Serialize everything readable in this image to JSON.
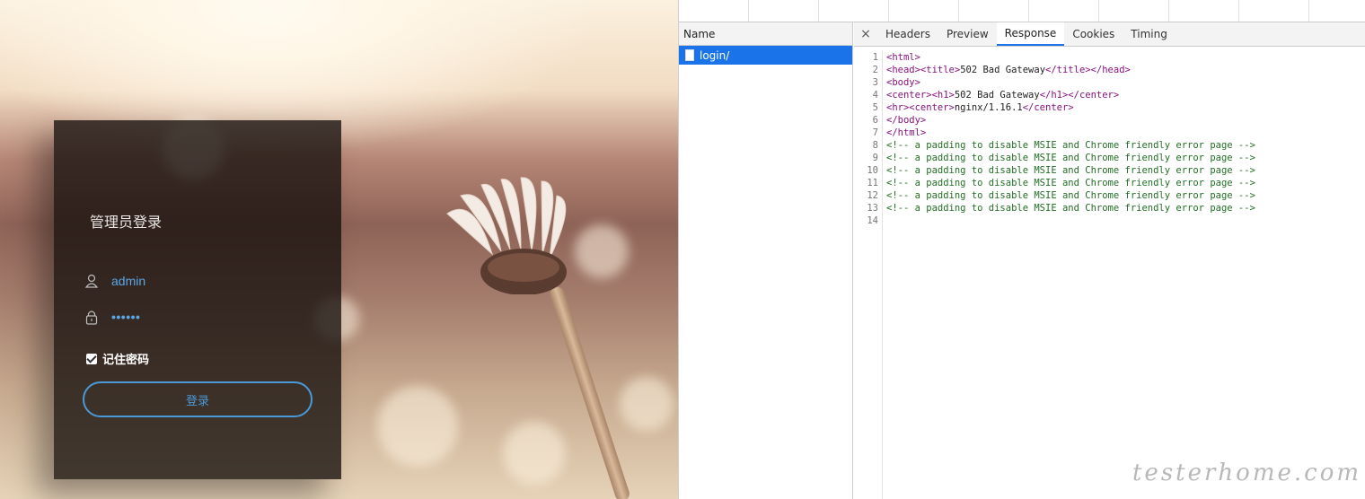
{
  "login": {
    "title": "管理员登录",
    "username": "admin",
    "password_masked": "••••••",
    "remember_label": "记住密码",
    "remember_checked": true,
    "button_label": "登录"
  },
  "devtools": {
    "name_header": "Name",
    "requests": [
      {
        "name": "login/",
        "selected": true
      }
    ],
    "tabs": [
      {
        "label": "Headers",
        "active": false
      },
      {
        "label": "Preview",
        "active": false
      },
      {
        "label": "Response",
        "active": true
      },
      {
        "label": "Cookies",
        "active": false
      },
      {
        "label": "Timing",
        "active": false
      }
    ],
    "close_glyph": "×",
    "response_lines": [
      {
        "n": "1",
        "text": "<html>",
        "kind": "tag"
      },
      {
        "n": "2",
        "parts": [
          [
            "<head><title>",
            "tag"
          ],
          [
            "502 Bad Gateway",
            "text"
          ],
          [
            "</title></head>",
            "tag"
          ]
        ]
      },
      {
        "n": "3",
        "text": "<body>",
        "kind": "tag"
      },
      {
        "n": "4",
        "parts": [
          [
            "<center><h1>",
            "tag"
          ],
          [
            "502 Bad Gateway",
            "text"
          ],
          [
            "</h1></center>",
            "tag"
          ]
        ]
      },
      {
        "n": "5",
        "parts": [
          [
            "<hr><center>",
            "tag"
          ],
          [
            "nginx/1.16.1",
            "text"
          ],
          [
            "</center>",
            "tag"
          ]
        ]
      },
      {
        "n": "6",
        "text": "</body>",
        "kind": "tag"
      },
      {
        "n": "7",
        "text": "</html>",
        "kind": "tag"
      },
      {
        "n": "8",
        "text": "<!-- a padding to disable MSIE and Chrome friendly error page -->",
        "kind": "comment"
      },
      {
        "n": "9",
        "text": "<!-- a padding to disable MSIE and Chrome friendly error page -->",
        "kind": "comment"
      },
      {
        "n": "10",
        "text": "<!-- a padding to disable MSIE and Chrome friendly error page -->",
        "kind": "comment"
      },
      {
        "n": "11",
        "text": "<!-- a padding to disable MSIE and Chrome friendly error page -->",
        "kind": "comment"
      },
      {
        "n": "12",
        "text": "<!-- a padding to disable MSIE and Chrome friendly error page -->",
        "kind": "comment"
      },
      {
        "n": "13",
        "text": "<!-- a padding to disable MSIE and Chrome friendly error page -->",
        "kind": "comment"
      },
      {
        "n": "14",
        "text": "",
        "kind": "text"
      }
    ]
  },
  "watermark": "testerhome.com",
  "colors": {
    "accent_blue": "#1a73e8",
    "login_blue": "#4a99d8",
    "tag": "#881280",
    "comment": "#236e25"
  },
  "icons": [
    "user-icon",
    "lock-icon",
    "close-icon",
    "document-icon"
  ]
}
